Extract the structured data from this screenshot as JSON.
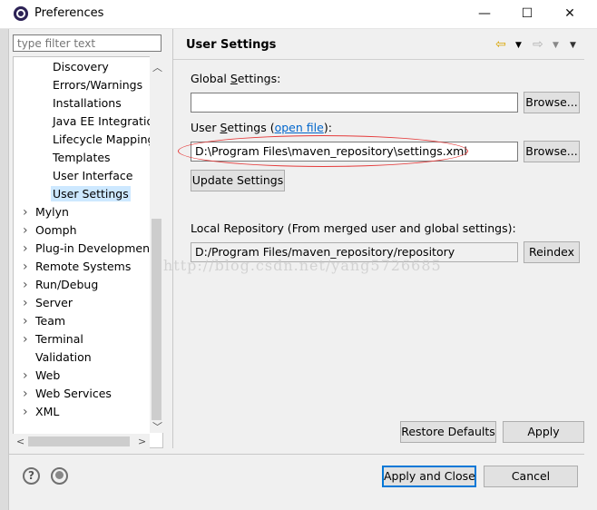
{
  "window": {
    "title": "Preferences",
    "minimize": "—",
    "maximize": "☐",
    "close": "✕"
  },
  "filter": {
    "placeholder": "type filter text"
  },
  "tree": {
    "items": [
      {
        "label": "Discovery",
        "expandable": false
      },
      {
        "label": "Errors/Warnings",
        "expandable": false
      },
      {
        "label": "Installations",
        "expandable": false
      },
      {
        "label": "Java EE Integratior",
        "expandable": false
      },
      {
        "label": "Lifecycle Mapping",
        "expandable": false
      },
      {
        "label": "Templates",
        "expandable": false
      },
      {
        "label": "User Interface",
        "expandable": false
      },
      {
        "label": "User Settings",
        "expandable": false,
        "selected": true
      },
      {
        "label": "Mylyn",
        "expandable": true
      },
      {
        "label": "Oomph",
        "expandable": true
      },
      {
        "label": "Plug-in Development",
        "expandable": true
      },
      {
        "label": "Remote Systems",
        "expandable": true
      },
      {
        "label": "Run/Debug",
        "expandable": true
      },
      {
        "label": "Server",
        "expandable": true
      },
      {
        "label": "Team",
        "expandable": true
      },
      {
        "label": "Terminal",
        "expandable": true
      },
      {
        "label": "Validation",
        "expandable": false
      },
      {
        "label": "Web",
        "expandable": true
      },
      {
        "label": "Web Services",
        "expandable": true
      },
      {
        "label": "XML",
        "expandable": true
      }
    ]
  },
  "page": {
    "title": "User Settings",
    "global_settings_label_pre": "Global ",
    "global_settings_label_ul": "S",
    "global_settings_label_post": "ettings:",
    "global_settings_value": "",
    "user_settings_label_pre": "User ",
    "user_settings_label_ul": "S",
    "user_settings_label_post": "ettings (",
    "user_settings_link": "open file",
    "user_settings_label_end": "):",
    "user_settings_value": "D:\\Program Files\\maven_repository\\settings.xml",
    "browse_label": "Browse...",
    "update_settings_label": "Update Settings",
    "local_repo_label": "Local Repository (From merged user and global settings):",
    "local_repo_value": "D:/Program Files/maven_repository/repository",
    "reindex_label": "Reindex",
    "restore_defaults_label": "Restore Defaults",
    "apply_label": "Apply"
  },
  "footer": {
    "apply_close_label": "Apply and Close",
    "cancel_label": "Cancel"
  },
  "watermark": "http://blog.csdn.net/yang5726685",
  "colors": {
    "accent": "#0078d7",
    "selection": "#cde8ff",
    "annotation": "#e53a3a",
    "link": "#0066cc"
  }
}
